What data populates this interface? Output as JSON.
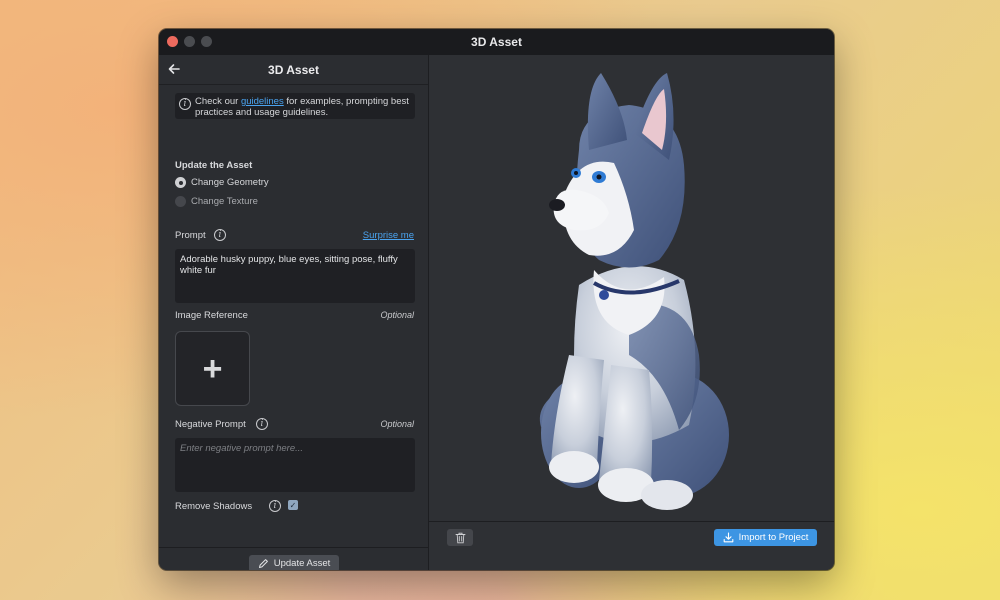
{
  "window": {
    "title": "3D Asset"
  },
  "panel": {
    "title": "3D Asset",
    "info_prefix": "Check our ",
    "info_link": "guidelines",
    "info_suffix": " for examples, prompting best practices and usage guidelines."
  },
  "update": {
    "heading": "Update the Asset",
    "options": [
      {
        "label": "Change Geometry",
        "selected": true
      },
      {
        "label": "Change Texture",
        "selected": false
      }
    ]
  },
  "prompt": {
    "label": "Prompt",
    "surprise": "Surprise me",
    "value": "Adorable husky puppy, blue eyes, sitting pose, fluffy white fur"
  },
  "image_reference": {
    "label": "Image Reference",
    "optional": "Optional"
  },
  "negative_prompt": {
    "label": "Negative Prompt",
    "optional": "Optional",
    "placeholder": "Enter negative prompt here..."
  },
  "remove_shadows": {
    "label": "Remove Shadows",
    "checked": true
  },
  "buttons": {
    "update_asset": "Update Asset",
    "import": "Import to Project"
  },
  "icons": {
    "back": "arrow-left-icon",
    "info": "info-icon",
    "plus": "plus-icon",
    "pencil": "pencil-icon",
    "trash": "trash-icon",
    "download": "download-icon"
  },
  "colors": {
    "accent": "#3d95e3",
    "link": "#4aa3ef",
    "panel_bg": "#2b2d31",
    "viewer_bg": "#2e3034"
  }
}
